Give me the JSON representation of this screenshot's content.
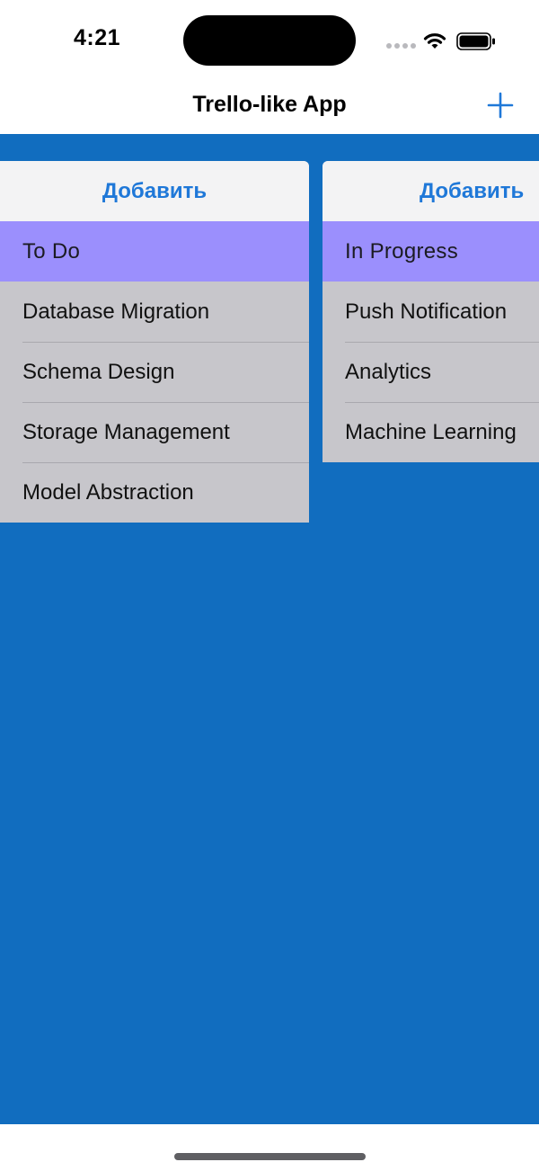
{
  "status_bar": {
    "time": "4:21",
    "icons": [
      "signal-icon",
      "wifi-icon",
      "battery-icon"
    ]
  },
  "nav": {
    "title": "Trello-like App",
    "add_icon": "plus-icon"
  },
  "colors": {
    "board_background": "#116dbf",
    "column_header": "#9b8ffd",
    "card_background": "#c7c6cb",
    "add_button_text": "#1f78d8"
  },
  "columns": [
    {
      "add_label": "Добавить",
      "title": "To Do",
      "cards": [
        "Database Migration",
        "Schema Design",
        "Storage Management",
        "Model Abstraction"
      ]
    },
    {
      "add_label": "Добавить",
      "title": "In Progress",
      "cards": [
        "Push Notification",
        "Analytics",
        "Machine Learning"
      ]
    }
  ]
}
